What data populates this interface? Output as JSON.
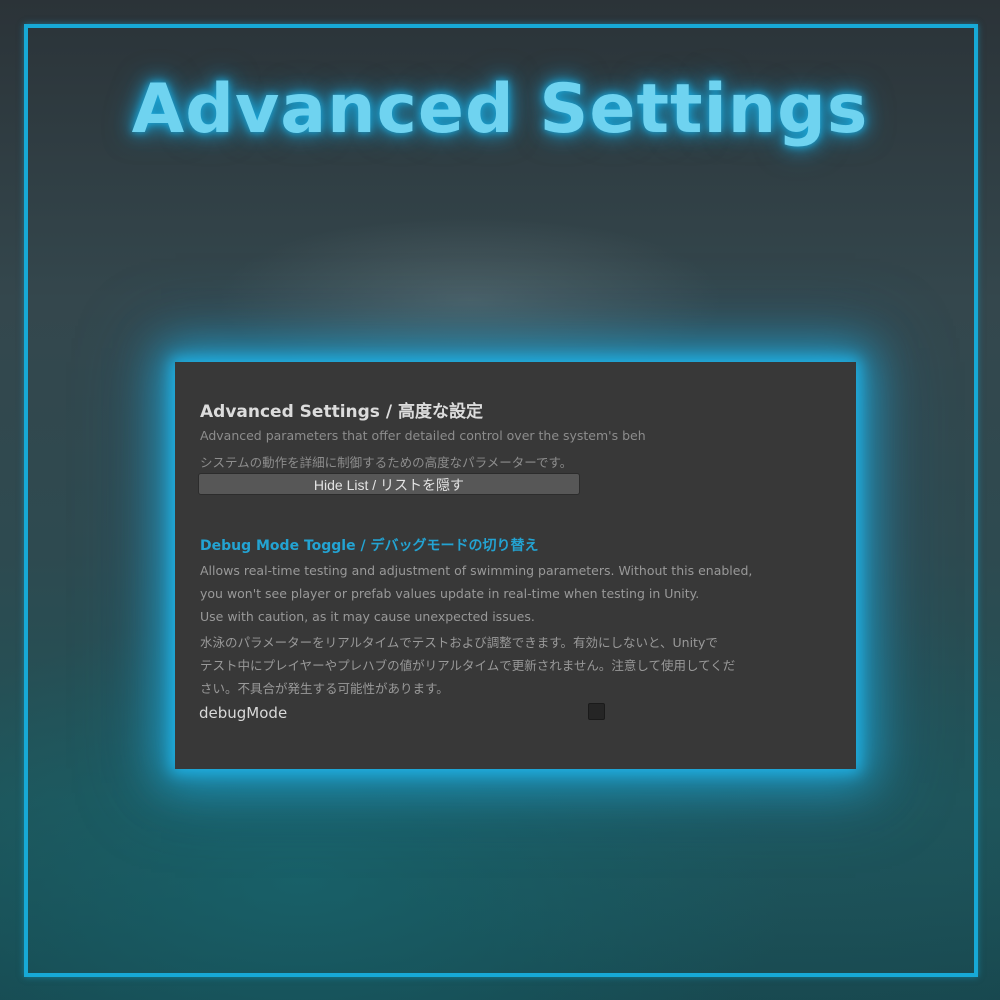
{
  "hero": {
    "title": "Advanced Settings"
  },
  "colors": {
    "accent": "#17a9d6",
    "panel_bg": "#383838",
    "toggle_title": "#23a3d2"
  },
  "section": {
    "title": "Advanced Settings / 高度な設定",
    "description_en": "Advanced parameters that offer detailed control over the system's beh",
    "description_ja": "システムの動作を詳細に制御するための高度なパラメーターです。",
    "hide_button_label": "Hide List / リストを隠す"
  },
  "debug": {
    "title": "Debug Mode Toggle / デバッグモードの切り替え",
    "description_lines": [
      "Allows real-time testing and adjustment of swimming parameters. Without this enabled,",
      "you won't see player or prefab values update in real-time when testing in Unity.",
      "Use with caution, as it may cause unexpected issues.",
      "水泳のパラメーターをリアルタイムでテストおよび調整できます。有効にしないと、Unityで",
      "テスト中にプレイヤーやプレハブの値がリアルタイムで更新されません。注意して使用してくだ",
      "さい。不具合が発生する可能性があります。"
    ],
    "field_label": "debugMode",
    "checked": false
  }
}
